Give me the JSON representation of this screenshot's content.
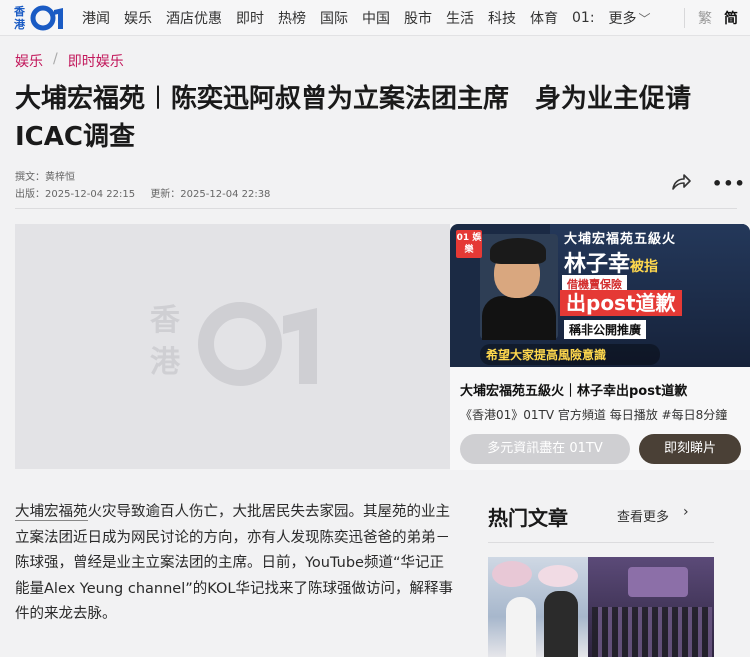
{
  "brand": {
    "han": "香港",
    "num": "01",
    "accent": "#1a5bc4"
  },
  "nav": {
    "items": [
      "港闻",
      "娱乐",
      "酒店优惠",
      "即时",
      "热榜",
      "国际",
      "中国",
      "股市",
      "生活",
      "科技",
      "体育",
      "01:"
    ],
    "more": "更多",
    "trad": "繁",
    "simp": "简"
  },
  "breadcrumb": [
    "娱乐",
    "即时娱乐"
  ],
  "headline": "大埔宏福苑︱陈奕迅阿叔曾为立案法团主席　身为业主促请ICAC调查",
  "meta": {
    "author": "撰文：黄梓恒",
    "published": "出版：2025-12-04 22:15",
    "updated": "更新：2025-12-04 22:38"
  },
  "placeholder": {
    "han": "香港"
  },
  "video": {
    "badge": "01 娛樂",
    "thumb_line1": "大埔宏福苑五級火",
    "thumb_name": "林子幸",
    "thumb_name_suffix": "被指",
    "thumb_red": "借機賣保險",
    "thumb_post": "出post道歉",
    "thumb_post2": "稱非公開推廣",
    "thumb_bottom": "希望大家提高風險意識",
    "title": "大埔宏福苑五級火｜林子幸出post道歉",
    "subtitle": "《香港01》01TV 官方頻道 每日播放 #每日8分鐘",
    "btn_more": "多元資訊盡在 01TV",
    "btn_watch": "即刻睇片"
  },
  "article": {
    "keyword": "大埔宏福苑",
    "p1_rest": "火灾导致逾百人伤亡，大批居民失去家园。其屋苑的业主立案法团近日成为网民讨论的方向，亦有人发现陈奕迅爸爸的弟弟－陈球强，曾经是业主立案法团的主席。日前，YouTube频道“华记正能量Alex Yeung channel”的KOL华记找来了陈球强做访问，解释事件的来龙去脉。"
  },
  "hot": {
    "title": "热门文章",
    "more": "查看更多"
  },
  "colors": {
    "breadcrumb": "#c2185b",
    "watch_button": "#4a4036"
  }
}
